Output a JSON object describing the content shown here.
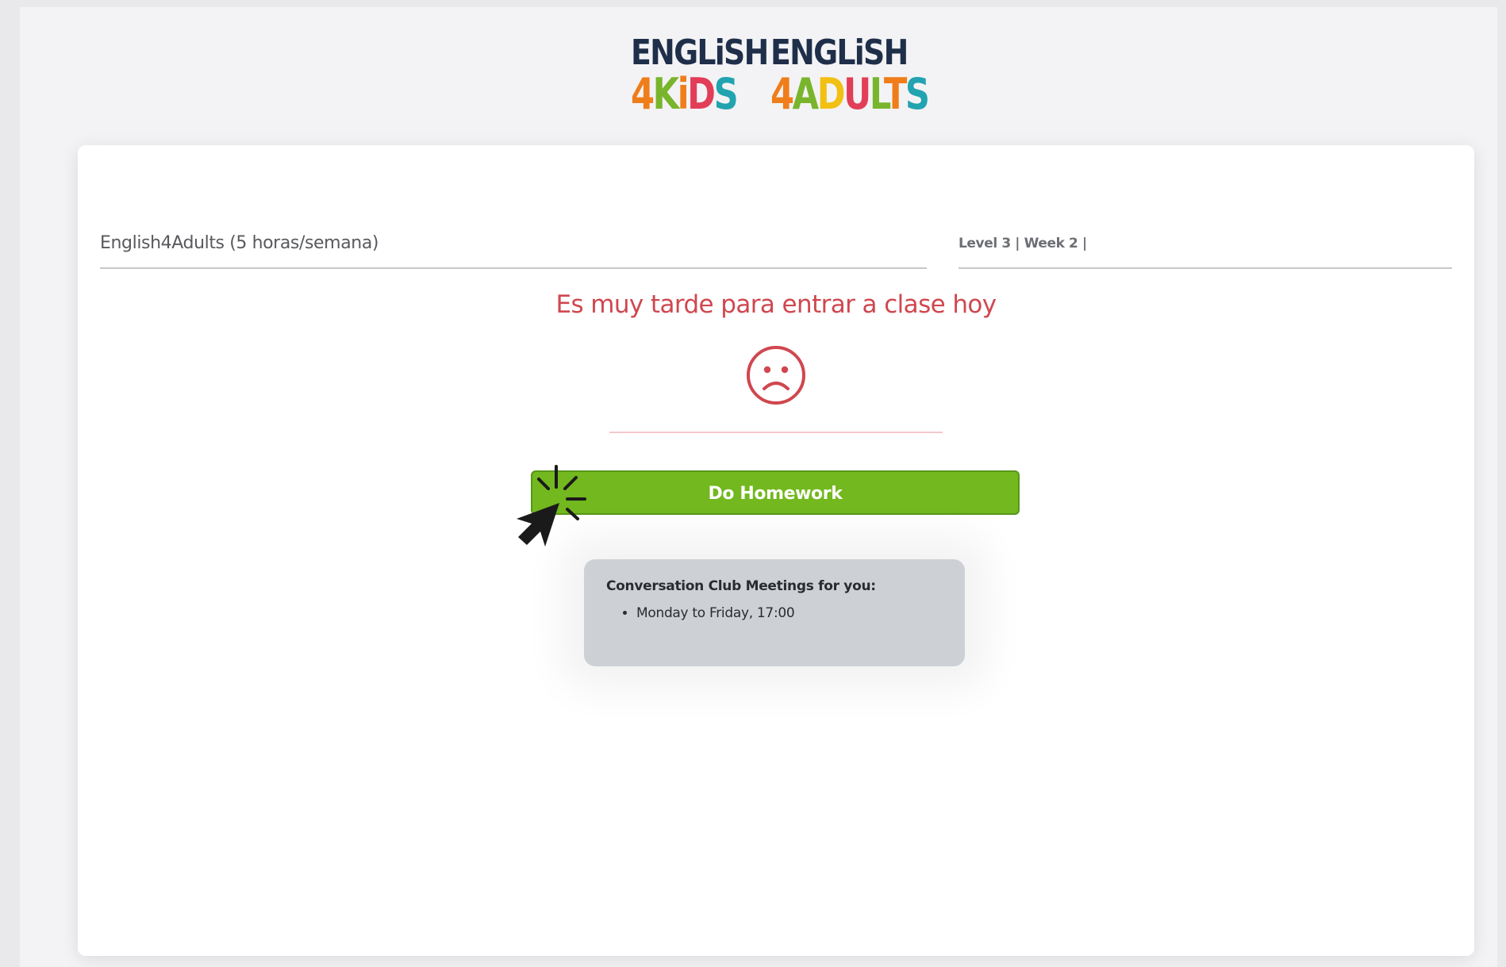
{
  "logos": [
    {
      "top": "ENGLiSH",
      "bottom": "4KiDS"
    },
    {
      "top": "ENGLiSH",
      "bottom": "4ADULTS"
    }
  ],
  "course": {
    "name": "English4Adults (5 horas/semana)",
    "level_info": "Level 3 | Week 2 |"
  },
  "status": {
    "message": "Es muy tarde para entrar a clase hoy",
    "icon": "sad-face-icon"
  },
  "homework_button": {
    "label": "Do Homework"
  },
  "club": {
    "title": "Conversation Club Meetings for you:",
    "items": [
      "Monday to Friday, 17:00"
    ]
  },
  "colors": {
    "accent_green": "#72b81e",
    "alert_red": "#d0474f",
    "logo_navy": "#1f2f4a",
    "kids_orange": "#ef7d1a",
    "kids_green": "#79b52c",
    "kids_pink": "#e23e57",
    "kids_teal": "#22a3b0"
  }
}
